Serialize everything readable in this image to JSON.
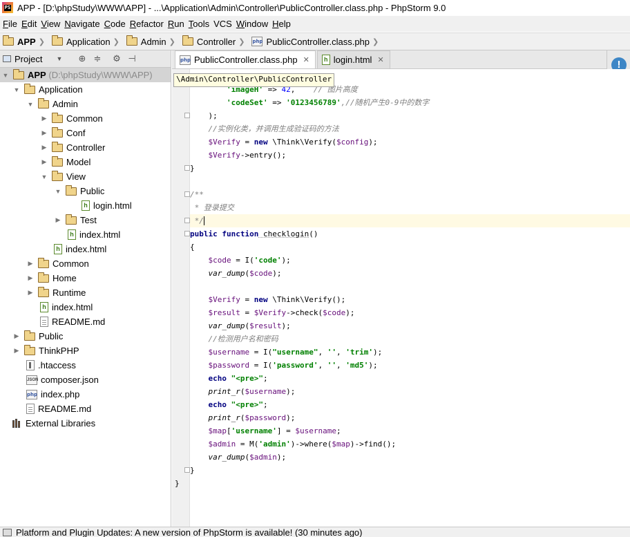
{
  "window": {
    "title": "APP - [D:\\phpStudy\\WWW\\APP] - ...\\Application\\Admin\\Controller\\PublicController.class.php - PhpStorm 9.0"
  },
  "menu": [
    {
      "label": "File",
      "u": "F",
      "rest": "ile"
    },
    {
      "label": "Edit",
      "u": "E",
      "rest": "dit"
    },
    {
      "label": "View",
      "u": "V",
      "rest": "iew"
    },
    {
      "label": "Navigate",
      "u": "N",
      "rest": "avigate"
    },
    {
      "label": "Code",
      "u": "C",
      "rest": "ode"
    },
    {
      "label": "Refactor",
      "u": "R",
      "rest": "efactor"
    },
    {
      "label": "Run",
      "u": "R",
      "rest": "un"
    },
    {
      "label": "Tools",
      "u": "T",
      "rest": "ools"
    },
    {
      "label": "VCS",
      "u": "",
      "rest": "VCS"
    },
    {
      "label": "Window",
      "u": "W",
      "rest": "indow"
    },
    {
      "label": "Help",
      "u": "H",
      "rest": "elp"
    }
  ],
  "navbar": {
    "crumbs": [
      "APP",
      "Application",
      "Admin",
      "Controller",
      "PublicController.class.php"
    ]
  },
  "project_panel": {
    "title": "Project",
    "root": {
      "name": "APP",
      "path": "(D:\\phpStudy\\WWW\\APP)"
    },
    "nodes": {
      "application": "Application",
      "admin": "Admin",
      "common": "Common",
      "conf": "Conf",
      "controller": "Controller",
      "model": "Model",
      "view": "View",
      "public": "Public",
      "login_html": "login.html",
      "test": "Test",
      "index_html_view": "index.html",
      "index_html_admin": "index.html",
      "common2": "Common",
      "home": "Home",
      "runtime": "Runtime",
      "index_html_app": "index.html",
      "readme_app": "README.md",
      "public_root": "Public",
      "thinkphp": "ThinkPHP",
      "htaccess": ".htaccess",
      "composer": "composer.json",
      "index_php": "index.php",
      "readme_root": "README.md",
      "external": "External Libraries"
    }
  },
  "editor": {
    "tabs": [
      {
        "label": "PublicController.class.php",
        "active": true
      },
      {
        "label": "login.html",
        "active": false
      }
    ],
    "breadcrumb_tooltip": "\\Admin\\Controller\\PublicController",
    "code": {
      "l1_key": "'imageH'",
      "l1_arrow": " => ",
      "l1_num": "42",
      "l1_rest": ",    ",
      "l1_comment": "// 图片高度",
      "l2_key": "'codeSet'",
      "l2_arrow": " => ",
      "l2_str": "'0123456789'",
      "l2_comment": ",//随机产生0-9中的数字",
      "l3": ");",
      "l4": "//实例化类，并调用生成验证码的方法",
      "l5_var": "$Verify",
      "l5_mid": " = ",
      "l5_kw": "new",
      "l5_cls": " \\Think\\Verify(",
      "l5_arg": "$config",
      "l5_end": ");",
      "l6_var": "$Verify",
      "l6_rest": "->entry();",
      "l7": "}",
      "l8": "/**",
      "l9": " * 登录提交",
      "l10": " */",
      "l11_kw": "public function",
      "l11_fn": " checklogin",
      "l11_end": "()",
      "l12": "{",
      "l13_var": "$code",
      "l13_mid": " = I(",
      "l13_str": "'code'",
      "l13_end": ");",
      "l14_fn": "var_dump",
      "l14_open": "(",
      "l14_var": "$code",
      "l14_end": ");",
      "l15": "",
      "l16_var": "$Verify",
      "l16_mid": " = ",
      "l16_kw": "new",
      "l16_end": " \\Think\\Verify();",
      "l17_var": "$result",
      "l17_mid": " = ",
      "l17_var2": "$Verify",
      "l17_mid2": "->check(",
      "l17_var3": "$code",
      "l17_end": ");",
      "l18_fn": "var_dump",
      "l18_open": "(",
      "l18_var": "$result",
      "l18_end": ");",
      "l19": "//检测用户名和密码",
      "l20_var": "$username",
      "l20_mid": " = I(",
      "l20_s1": "\"username\"",
      "l20_c1": ", ",
      "l20_s2": "''",
      "l20_c2": ", ",
      "l20_s3": "'trim'",
      "l20_end": ");",
      "l21_var": "$password",
      "l21_mid": " = I(",
      "l21_s1": "'password'",
      "l21_c1": ", ",
      "l21_s2": "''",
      "l21_c2": ", ",
      "l21_s3": "'md5'",
      "l21_end": ");",
      "l22_kw": "echo",
      "l22_str": " \"<pre>\"",
      "l22_end": ";",
      "l23_fn": "print_r",
      "l23_open": "(",
      "l23_var": "$username",
      "l23_end": ");",
      "l24_kw": "echo",
      "l24_str": " \"<pre>\"",
      "l24_end": ";",
      "l25_fn": "print_r",
      "l25_open": "(",
      "l25_var": "$password",
      "l25_end": ");",
      "l26_var": "$map",
      "l26_open": "[",
      "l26_str": "'username'",
      "l26_mid": "] = ",
      "l26_var2": "$username",
      "l26_end": ";",
      "l27_var": "$admin",
      "l27_mid": " = M(",
      "l27_str": "'admin'",
      "l27_mid2": ")->where(",
      "l27_var2": "$map",
      "l27_end": ")->find();",
      "l28_fn": "var_dump",
      "l28_open": "(",
      "l28_var": "$admin",
      "l28_end": ");",
      "l29": "}",
      "l30": "}"
    }
  },
  "status_bar": {
    "message": "Platform and Plugin Updates: A new version of PhpStorm is available! (30 minutes ago)"
  },
  "colors": {
    "keyword": "#000080",
    "string": "#008000",
    "number": "#0000ff",
    "comment": "#808080",
    "variable": "#660e7a",
    "current_line": "#fffae3"
  }
}
